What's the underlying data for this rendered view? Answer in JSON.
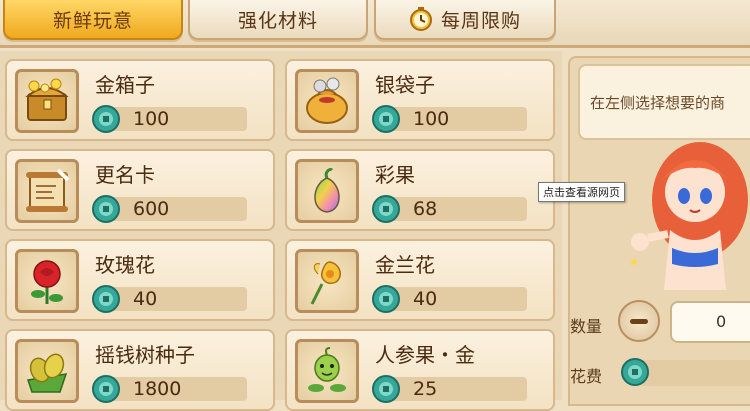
{
  "tabs": [
    {
      "label": "新鲜玩意",
      "active": true
    },
    {
      "label": "强化材料",
      "active": false
    },
    {
      "label": "每周限购",
      "active": false,
      "icon": "clock-icon"
    }
  ],
  "items": [
    {
      "name": "金箱子",
      "price": "100",
      "icon": "gold-chest-icon"
    },
    {
      "name": "银袋子",
      "price": "100",
      "icon": "silver-bag-icon"
    },
    {
      "name": "更名卡",
      "price": "600",
      "icon": "rename-scroll-icon"
    },
    {
      "name": "彩果",
      "price": "68",
      "icon": "rainbow-fruit-icon"
    },
    {
      "name": "玫瑰花",
      "price": "40",
      "icon": "rose-icon"
    },
    {
      "name": "金兰花",
      "price": "40",
      "icon": "golden-orchid-icon"
    },
    {
      "name": "摇钱树种子",
      "price": "1800",
      "icon": "money-tree-seed-icon"
    },
    {
      "name": "人参果・金",
      "price": "25",
      "icon": "ginseng-fruit-icon"
    }
  ],
  "panel": {
    "hint": "在左侧选择想要的商",
    "quantity_label": "数量",
    "quantity_value": "0",
    "cost_label": "花费"
  },
  "tooltip": "点击查看源网页",
  "colors": {
    "active_tab": "#f0a91e",
    "coin": "#35a89a",
    "text": "#4a2a10"
  }
}
